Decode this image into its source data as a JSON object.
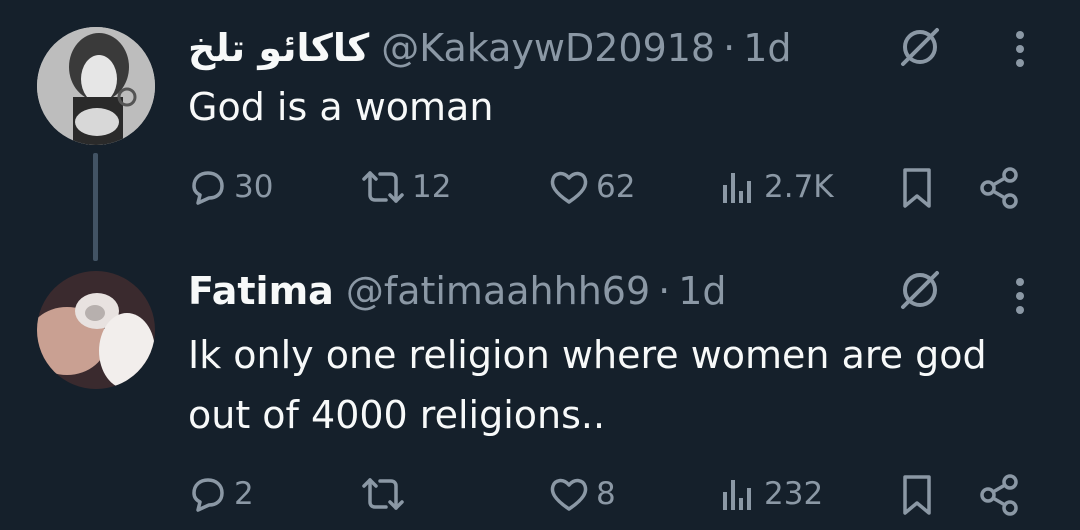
{
  "tweets": [
    {
      "display_name": "کاکائو تلخ",
      "handle": "@KakaywD20918",
      "separator": "·",
      "time": "1d",
      "text": "God is a woman",
      "replies": "30",
      "reposts": "12",
      "likes": "62",
      "views": "2.7K"
    },
    {
      "display_name": "Fatima",
      "handle": "@fatimaahhh69",
      "separator": "·",
      "time": "1d",
      "text_line1": "Ik only one religion where women are god",
      "text_line2": "out of 4000 religions..",
      "replies": "2",
      "reposts": "",
      "likes": "8",
      "views": "232"
    }
  ],
  "colors": {
    "background": "#15202b",
    "text": "#f7f9f9",
    "muted": "#8b98a5",
    "thread_line": "#425364"
  }
}
